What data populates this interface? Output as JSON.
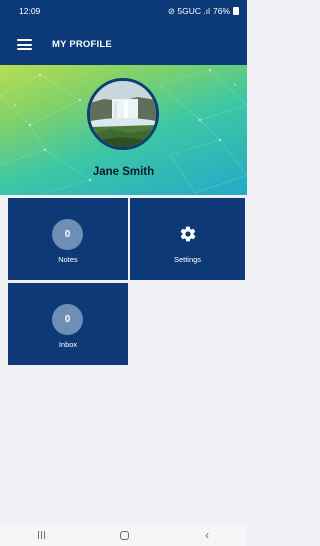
{
  "status_bar": {
    "time": "12:09",
    "network": "∉̸ 5GUC .ıl",
    "battery": "76%"
  },
  "app_bar": {
    "title": "MY PROFILE",
    "menu_icon": "hamburger-menu-icon"
  },
  "profile": {
    "name": "Jane Smith",
    "avatar": "waterfall-photo"
  },
  "tiles": [
    {
      "label": "Notes",
      "count": "0"
    },
    {
      "label": "Settings",
      "icon": "gear-icon"
    },
    {
      "label": "Inbox",
      "count": "0"
    }
  ],
  "nav_bar": {
    "recents": "recents-icon",
    "home": "home-icon",
    "back": "back-icon"
  },
  "colors": {
    "primary": "#0c3a78",
    "badge": "#6e8eb5",
    "background": "#f0f0f4"
  }
}
